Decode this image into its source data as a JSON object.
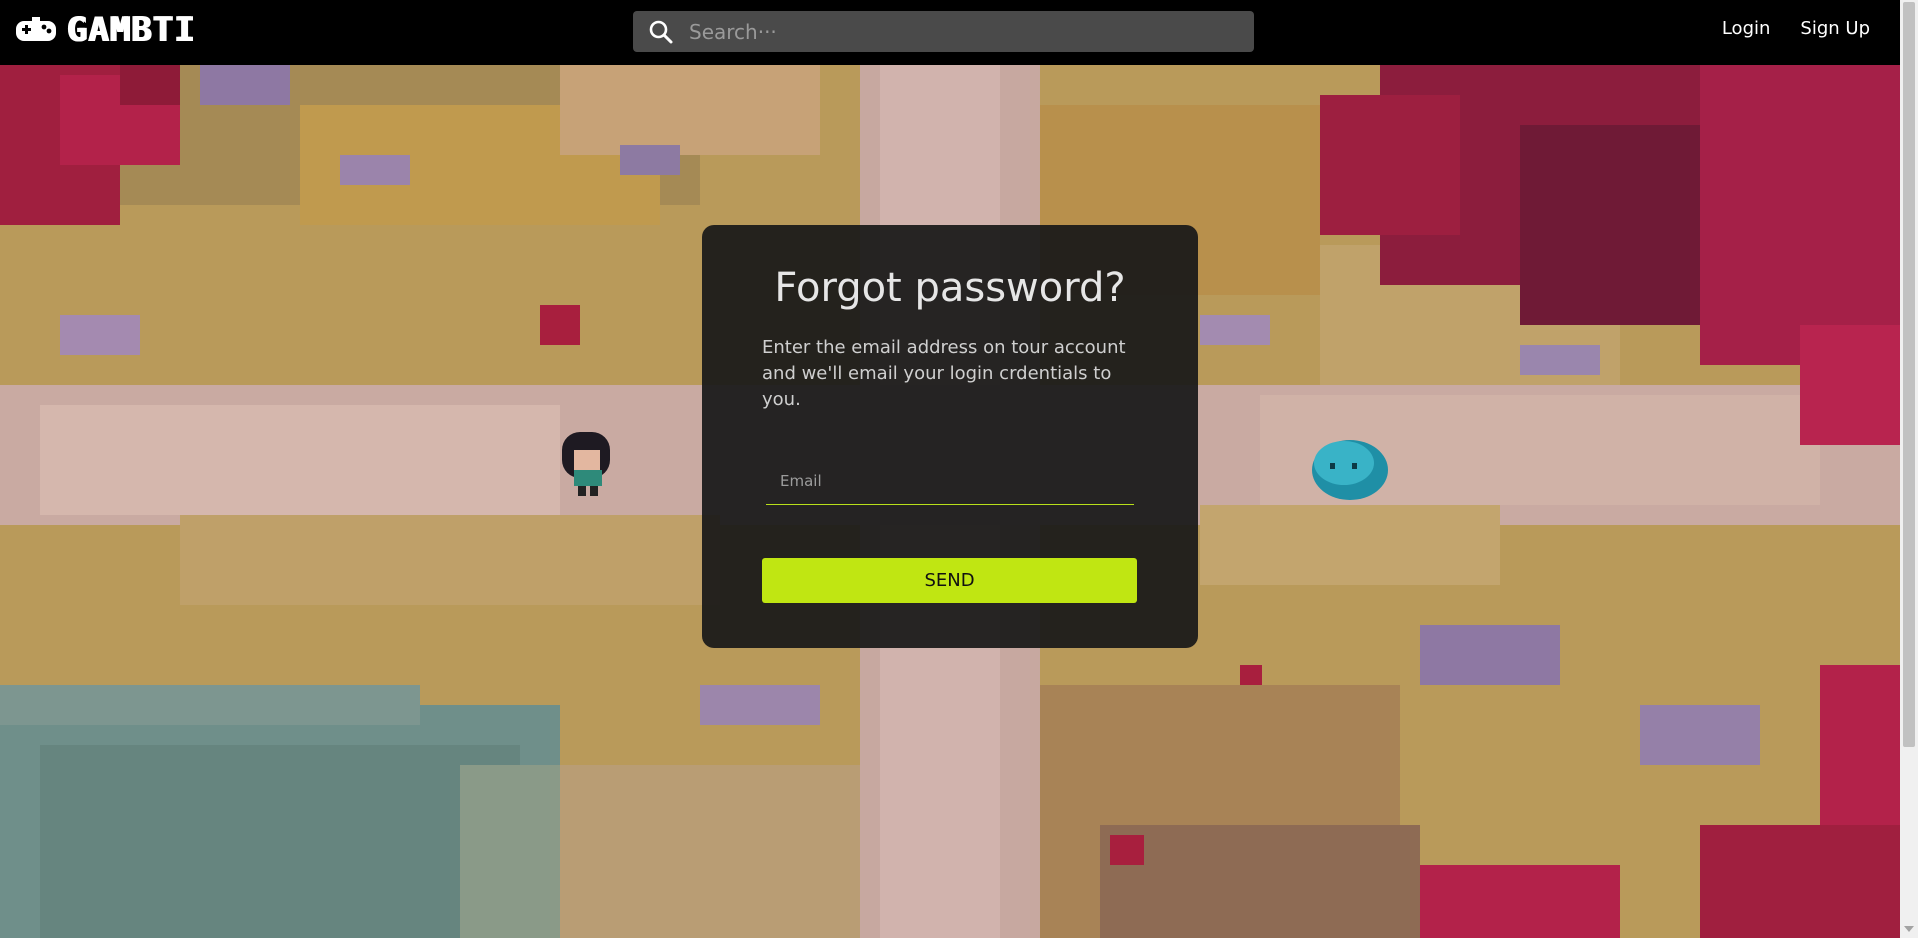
{
  "header": {
    "logo_text": "GAMBTI",
    "search": {
      "placeholder": "Search···",
      "value": ""
    },
    "nav": {
      "login": "Login",
      "signup": "Sign Up"
    }
  },
  "card": {
    "title": "Forgot password?",
    "description": "Enter the email address on tour account and we'll email your login crdentials to you.",
    "email": {
      "placeholder": "Email",
      "value": ""
    },
    "send_label": "SEND"
  },
  "colors": {
    "accent": "#c0e612",
    "topbar": "#000000",
    "card_bg": "#191919"
  },
  "icons": {
    "search": "search-icon",
    "logo": "gamepad-logo-icon"
  }
}
